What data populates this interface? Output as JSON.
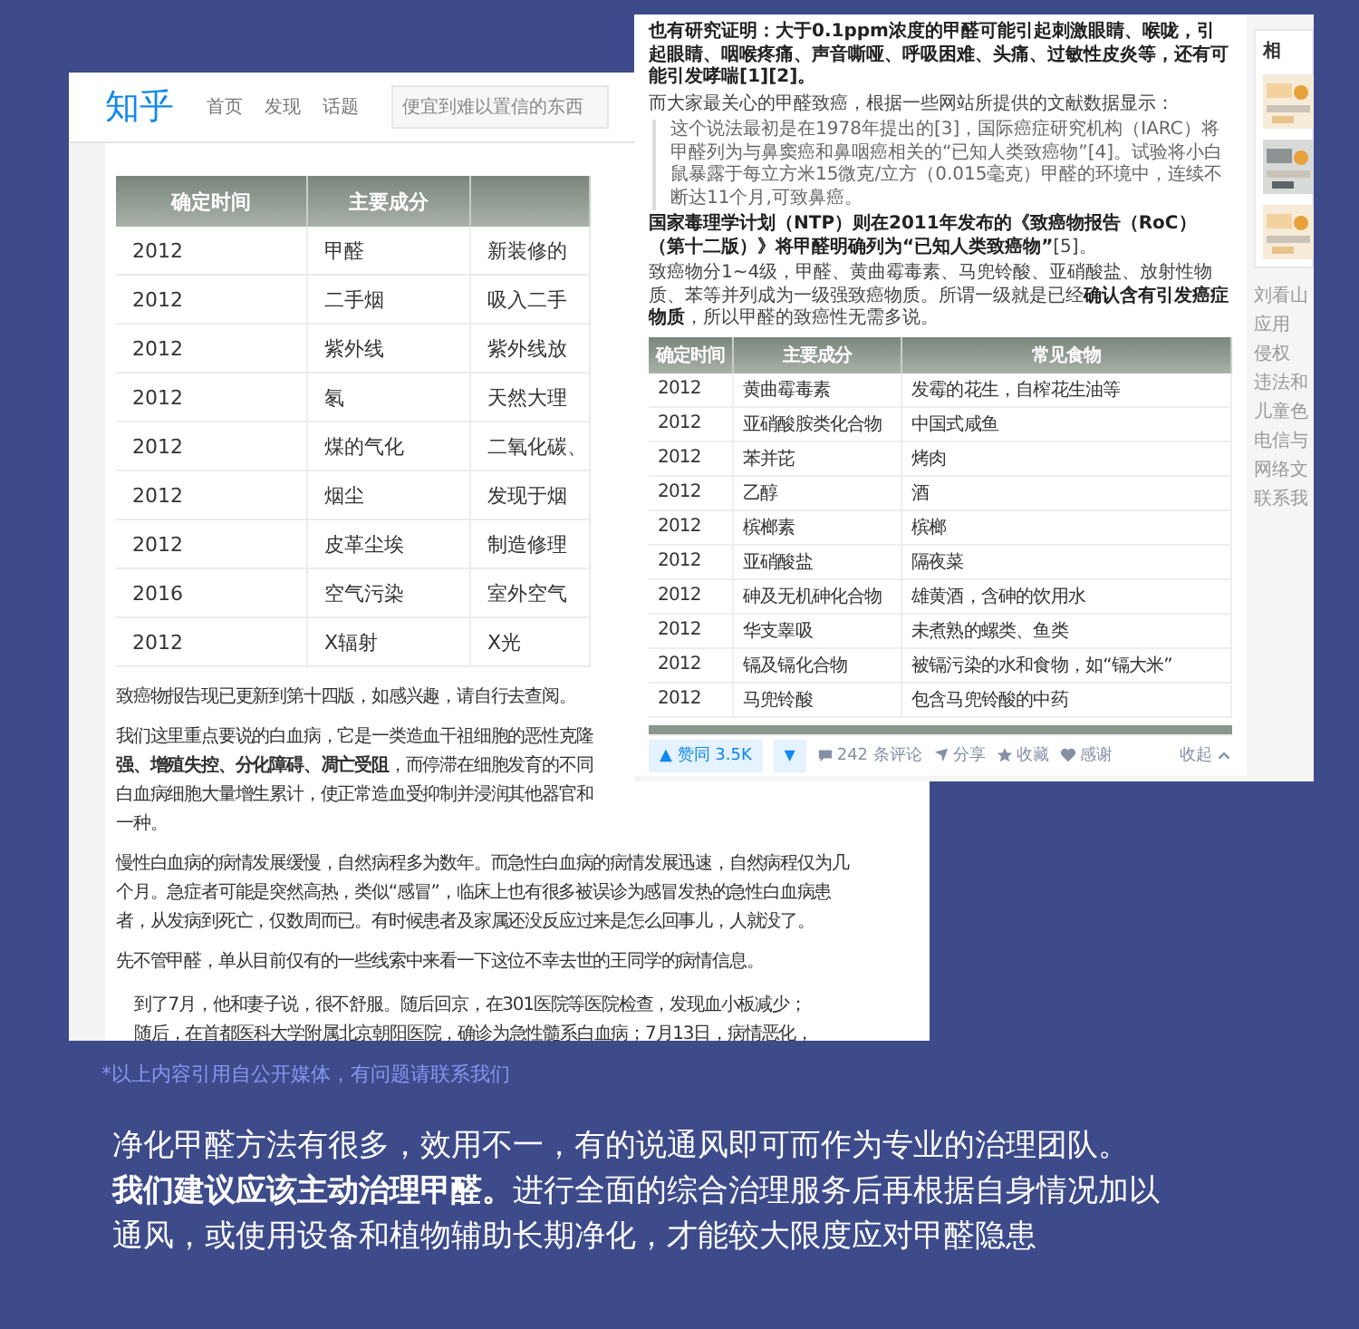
{
  "left_page": {
    "header": {
      "logo": "知乎",
      "nav": [
        {
          "label": "首页"
        },
        {
          "label": "发现"
        },
        {
          "label": "话题"
        }
      ],
      "search": {
        "placeholder": "便宜到难以置信的东西"
      }
    },
    "table": {
      "columns": [
        "确定时间",
        "主要成分"
      ],
      "rows": [
        [
          "2012",
          "甲醛",
          "新装修的"
        ],
        [
          "2012",
          "二手烟",
          "吸入二手"
        ],
        [
          "2012",
          "紫外线",
          "紫外线放"
        ],
        [
          "2012",
          "氡",
          "天然大理"
        ],
        [
          "2012",
          "煤的气化",
          "二氧化碳、"
        ],
        [
          "2012",
          "烟尘",
          "发现于烟"
        ],
        [
          "2012",
          "皮革尘埃",
          "制造修理"
        ],
        [
          "2016",
          "空气污染",
          "室外空气"
        ],
        [
          "2012",
          "X辐射",
          "X光"
        ]
      ]
    },
    "paragraphs": [
      {
        "kind": "text",
        "lines": [
          "致癌物报告现已更新到第十四版，如感兴趣，请自行去查阅。"
        ]
      },
      {
        "kind": "text",
        "lines": [
          "我们这里重点要说的白血病，它是一类造血干祖细胞的恶性克隆",
          "**强、增殖失控、分化障碍、凋亡受阻**，而停滞在细胞发育的不同",
          "白血病细胞大量增生累计，使正常造血受抑制并浸润其他器官和",
          "一种。"
        ]
      },
      {
        "kind": "text",
        "lines": [
          "慢性白血病的病情发展缓慢，自然病程多为数年。而急性白血病的病情发展迅速，自然病程仅为几",
          "个月。急症者可能是突然高热，类似“感冒”，临床上也有很多被误诊为感冒发热的急性白血病患",
          "者，从发病到死亡，仅数周而已。有时候患者及家属还没反应过来是怎么回事儿，人就没了。"
        ]
      },
      {
        "kind": "text",
        "lines": [
          "先不管甲醛，单从目前仅有的一些线索中来看一下这位不幸去世的王同学的病情信息。"
        ]
      },
      {
        "kind": "quote",
        "lines": [
          "到了7月，他和妻子说，很不舒服。随后回京，在301医院等医院检查，发现血小板减少；",
          "随后，在首都医科大学附属北京朝阳医院，确诊为急性髓系白血病；7月13日，病情恶化，"
        ]
      }
    ]
  },
  "right_page": {
    "paragraphs": [
      {
        "kind": "bold",
        "text": "也有研究证明：大于0.1ppm浓度的甲醛可能引起刺激眼睛、喉咙，引起眼睛、咽喉疼痛、声音嘶哑、呼吸困难、头痛、过敏性皮炎等，还有可能引发哮喘[1][2]。"
      },
      {
        "kind": "text",
        "text": "而大家最关心的甲醛致癌，根据一些网站所提供的文献数据显示："
      },
      {
        "kind": "quote",
        "text": "这个说法最初是在1978年提出的[3]，国际癌症研究机构（IARC）将甲醛列为与鼻窦癌和鼻咽癌相关的“已知人类致癌物”[4]。试验将小白鼠暴露于每立方米15微克/立方（0.015毫克）甲醛的环境中，连续不断达11个月,可致鼻癌。"
      },
      {
        "kind": "text",
        "text": "**国家毒理学计划（NTP）则在2011年发布的《致癌物报告（RoC）（第十二版）》将甲醛明确列为“已知人类致癌物”**[5]。"
      },
      {
        "kind": "text",
        "text": "致癌物分1~4级，甲醛、黄曲霉毒素、马兜铃酸、亚硝酸盐、放射性物质、苯等并列成为一级强致癌物质。所谓一级就是已经**确认含有引发癌症物质**，所以甲醛的致癌性无需多说。"
      }
    ],
    "table": {
      "columns": [
        "确定时间",
        "主要成分",
        "常见食物"
      ],
      "rows": [
        [
          "2012",
          "黄曲霉毒素",
          "发霉的花生，自榨花生油等"
        ],
        [
          "2012",
          "亚硝酸胺类化合物",
          "中国式咸鱼"
        ],
        [
          "2012",
          "苯并芘",
          "烤肉"
        ],
        [
          "2012",
          "乙醇",
          "酒"
        ],
        [
          "2012",
          "槟榔素",
          "槟榔"
        ],
        [
          "2012",
          "亚硝酸盐",
          "隔夜菜"
        ],
        [
          "2012",
          "砷及无机砷化合物",
          "雄黄酒，含砷的饮用水"
        ],
        [
          "2012",
          "华支睾吸",
          "未煮熟的螺类、鱼类"
        ],
        [
          "2012",
          "镉及镉化合物",
          "被镉污染的水和食物，如“镉大米”"
        ],
        [
          "2012",
          "马兜铃酸",
          "包含马兜铃酸的中药"
        ]
      ]
    },
    "actions": {
      "upvote": "▲ 赞同 3.5K",
      "downvote": "▼",
      "items": [
        {
          "kind": "comment",
          "label": "242 条评论"
        },
        {
          "kind": "share",
          "label": "分享"
        },
        {
          "kind": "star",
          "label": "收藏"
        },
        {
          "kind": "heart",
          "label": "感谢"
        }
      ],
      "collapse": "收起"
    },
    "sidebar": {
      "title": "相",
      "thumbnails": [
        {
          "kind": "picture"
        },
        {
          "kind": "picture"
        },
        {
          "kind": "picture"
        }
      ],
      "links": [
        "刘看山",
        "应用",
        "侵权",
        "违法和",
        "儿童色",
        "电信与",
        "网络文",
        "联系我"
      ]
    }
  },
  "footer": {
    "note": "*以上内容引用自公开媒体，有问题请联系我们",
    "lines": [
      "净化甲醛方法有很多，效用不一，有的说通风即可而作为专业的治理团队。",
      "**我们建议应该主动治理甲醛。**进行全面的综合治理服务后再根据自身情况加以通风，或使用设备和植物辅助长期净化，才能较大限度应对甲醛隐患"
    ]
  }
}
